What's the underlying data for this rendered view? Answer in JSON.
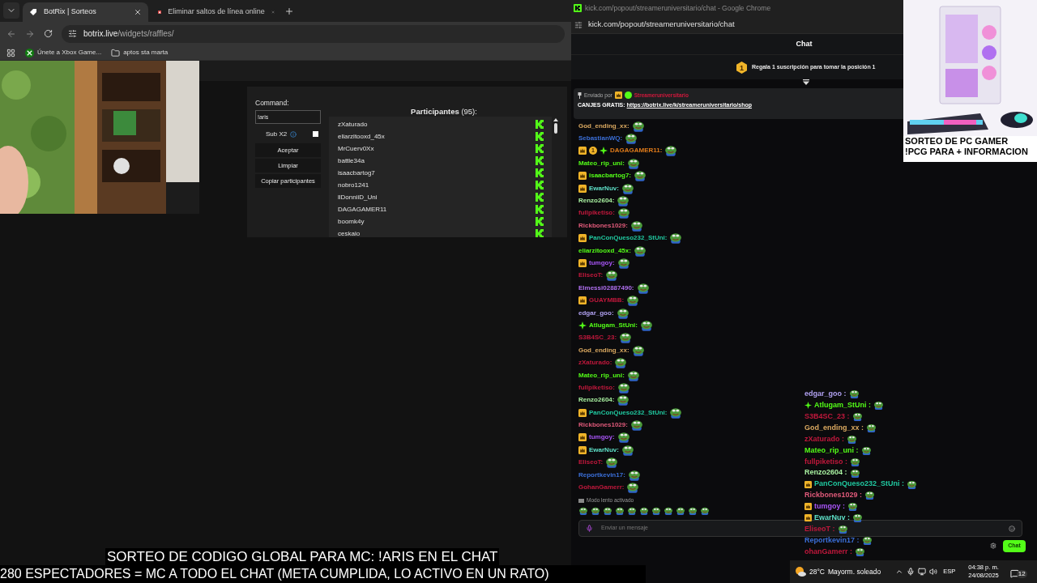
{
  "left_browser": {
    "tabs": [
      {
        "title": "BotRix | Sorteos",
        "selected": true
      },
      {
        "title": "Eliminar saltos de línea online",
        "selected": false
      }
    ],
    "address": {
      "host": "botrix.live",
      "path": "/widgets/raffles/"
    },
    "bookmarks": [
      {
        "label": "Únete a Xbox Game...",
        "kind": "link"
      },
      {
        "label": "aptos sta marta",
        "kind": "folder"
      }
    ]
  },
  "raffle": {
    "command_label": "Command:",
    "command_value": "!aris",
    "sub_x2": {
      "label": "Sub X2",
      "checked": false
    },
    "buttons": [
      "Aceptar",
      "Limpiar",
      "Copiar participantes"
    ],
    "participants_title": "Participantes",
    "participants_count": "(95):",
    "participants": [
      "zXaturado",
      "eliarzitooxd_45x",
      "MrCuerv0Xx",
      "battle34a",
      "isaacbartog7",
      "nobro1241",
      "llDonniiD_Uni",
      "DAGAGAMER11",
      "boomk4y",
      "ceskaio"
    ]
  },
  "chat_window": {
    "title": "kick.com/popout/streameruniversitario/chat - Google Chrome",
    "url": "kick.com/popout/streameruniversitario/chat",
    "header": "Chat",
    "gift_prompt": {
      "rank": "1",
      "text": "Regala 1 suscripción para tomar la posición 1"
    },
    "pinned": {
      "sent_by": "Enviado por",
      "sender": "Streameruniversitario",
      "prefix": "CANJES GRATIS:",
      "link": "https://botrix.live/k/streameruniversitario/shop"
    },
    "messages": [
      {
        "user": "God_ending_xx:",
        "color": "#d9a860"
      },
      {
        "user": "SebastianWQ:",
        "color": "#3b6fd8"
      },
      {
        "user": "DAGAGAMER11:",
        "color": "#e07b1a",
        "badges": [
          {
            "kind": "subscriber"
          },
          {
            "kind": "gifter",
            "text": "1"
          },
          {
            "kind": "og"
          }
        ]
      },
      {
        "user": "Mateo_rip_uni:",
        "color": "#53fc18"
      },
      {
        "user": "isaacbartog7:",
        "color": "#53fc18",
        "badges": [
          {
            "kind": "subscriber"
          }
        ]
      },
      {
        "user": "EwarNuv:",
        "color": "#5ee0c8",
        "badges": [
          {
            "kind": "subscriber"
          }
        ]
      },
      {
        "user": "Renzo2604:",
        "color": "#a8f0a0"
      },
      {
        "user": "fullpiketiso:",
        "color": "#c0183c"
      },
      {
        "user": "Rickbones1029:",
        "color": "#e05a7a"
      },
      {
        "user": "PanConQueso232_StUni:",
        "color": "#20c9a0",
        "badges": [
          {
            "kind": "subscriber"
          }
        ]
      },
      {
        "user": "eliarzitooxd_45x:",
        "color": "#53fc18"
      },
      {
        "user": "tumgoy:",
        "color": "#a855f7",
        "badges": [
          {
            "kind": "subscriber"
          }
        ]
      },
      {
        "user": "EliseoT:",
        "color": "#c0183c"
      },
      {
        "user": "Elmessi02887490:",
        "color": "#b070f0"
      },
      {
        "user": "GUAYMBB:",
        "color": "#c0183c",
        "badges": [
          {
            "kind": "subscriber"
          }
        ]
      },
      {
        "user": "edgar_goo:",
        "color": "#b0a0f0"
      },
      {
        "user": "Atlugam_StUni:",
        "color": "#53fc18",
        "badges": [
          {
            "kind": "og"
          }
        ]
      },
      {
        "user": "S3B4SC_23:",
        "color": "#c0183c"
      },
      {
        "user": "God_ending_xx:",
        "color": "#d9a860"
      },
      {
        "user": "zXaturado:",
        "color": "#c0183c"
      },
      {
        "user": "Mateo_rip_uni:",
        "color": "#53fc18"
      },
      {
        "user": "fullpiketiso:",
        "color": "#c0183c"
      },
      {
        "user": "Renzo2604:",
        "color": "#a8f0a0"
      },
      {
        "user": "PanConQueso232_StUni:",
        "color": "#20c9a0",
        "badges": [
          {
            "kind": "subscriber"
          }
        ]
      },
      {
        "user": "Rickbones1029:",
        "color": "#e05a7a"
      },
      {
        "user": "tumgoy:",
        "color": "#a855f7",
        "badges": [
          {
            "kind": "subscriber"
          }
        ]
      },
      {
        "user": "EwarNuv:",
        "color": "#5ee0c8",
        "badges": [
          {
            "kind": "subscriber"
          }
        ]
      },
      {
        "user": "EliseoT:",
        "color": "#c0183c"
      },
      {
        "user": "Reportkevin17:",
        "color": "#3b6fd8"
      },
      {
        "user": "GohanGamerr:",
        "color": "#c0183c"
      }
    ],
    "slow_mode": "Modo lento activado",
    "input_placeholder": "Enviar un mensaje",
    "send": "Chat"
  },
  "promo": {
    "lines": [
      "SORTEO DE PC GAMER",
      "!PCG PARA + INFORMACION"
    ]
  },
  "overlay_chat": {
    "messages": [
      {
        "user": "edgar_goo :",
        "color": "#b0a0f0"
      },
      {
        "user": "Atlugam_StUni :",
        "color": "#53fc18",
        "badges": [
          {
            "kind": "og"
          }
        ]
      },
      {
        "user": "S3B4SC_23 :",
        "color": "#c0183c"
      },
      {
        "user": "God_ending_xx :",
        "color": "#d9a860"
      },
      {
        "user": "zXaturado :",
        "color": "#c0183c"
      },
      {
        "user": "Mateo_rip_uni :",
        "color": "#53fc18"
      },
      {
        "user": "fullpiketiso :",
        "color": "#c0183c"
      },
      {
        "user": "Renzo2604 :",
        "color": "#a8f0a0"
      },
      {
        "user": "PanConQueso232_StUni :",
        "color": "#20c9a0",
        "badges": [
          {
            "kind": "subscriber"
          }
        ]
      },
      {
        "user": "Rickbones1029 :",
        "color": "#e05a7a"
      },
      {
        "user": "tumgoy :",
        "color": "#a855f7",
        "badges": [
          {
            "kind": "subscriber"
          }
        ]
      },
      {
        "user": "EwarNuv :",
        "color": "#5ee0c8",
        "badges": [
          {
            "kind": "subscriber"
          }
        ]
      },
      {
        "user": "EliseoT :",
        "color": "#c0183c"
      },
      {
        "user": "Reportkevin17 :",
        "color": "#3b6fd8"
      },
      {
        "user": "ohanGamerr :",
        "color": "#c0183c"
      }
    ]
  },
  "caption": {
    "lines": [
      "SORTEO DE CODIGO GLOBAL PARA MC: !ARIS EN EL CHAT",
      "280 ESPECTADORES = MC A TODO EL CHAT (META CUMPLIDA, LO ACTIVO EN UN RATO)"
    ]
  },
  "taskbar": {
    "temperature": "28°C",
    "weather": "Mayorm. soleado",
    "language": "ESP",
    "time": "04:38 p. m.",
    "date": "24/08/2025",
    "notifications": "12"
  }
}
